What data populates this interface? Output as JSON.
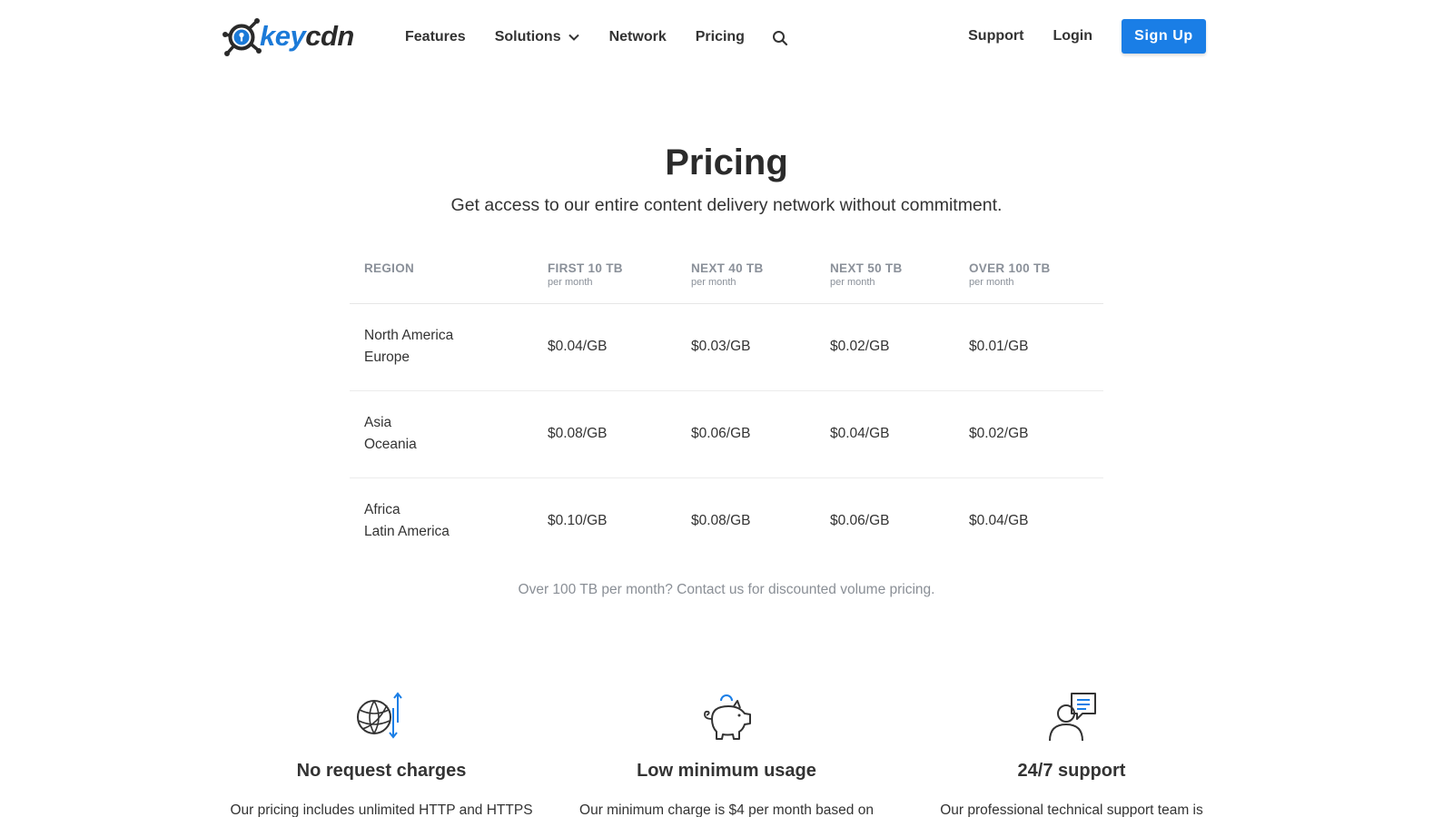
{
  "brand": {
    "key": "key",
    "cdn": "cdn",
    "accent": "#1a7ee6"
  },
  "nav": {
    "items": [
      {
        "label": "Features"
      },
      {
        "label": "Solutions"
      },
      {
        "label": "Network"
      },
      {
        "label": "Pricing"
      }
    ],
    "support": "Support",
    "login": "Login",
    "signup": "Sign Up"
  },
  "hero": {
    "title": "Pricing",
    "subtitle": "Get access to our entire content delivery network without commitment."
  },
  "table": {
    "columns": [
      {
        "label": "REGION",
        "sub": ""
      },
      {
        "label": "FIRST 10 TB",
        "sub": "per month"
      },
      {
        "label": "NEXT 40 TB",
        "sub": "per month"
      },
      {
        "label": "NEXT 50 TB",
        "sub": "per month"
      },
      {
        "label": "OVER 100 TB",
        "sub": "per month"
      }
    ],
    "rows": [
      {
        "region": [
          "North America",
          "Europe"
        ],
        "prices": [
          "$0.04/GB",
          "$0.03/GB",
          "$0.02/GB",
          "$0.01/GB"
        ]
      },
      {
        "region": [
          "Asia",
          "Oceania"
        ],
        "prices": [
          "$0.08/GB",
          "$0.06/GB",
          "$0.04/GB",
          "$0.02/GB"
        ]
      },
      {
        "region": [
          "Africa",
          "Latin America"
        ],
        "prices": [
          "$0.10/GB",
          "$0.08/GB",
          "$0.06/GB",
          "$0.04/GB"
        ]
      }
    ]
  },
  "volume_note": {
    "prefix": "Over 100 TB per month? ",
    "link": "Contact us",
    "suffix": " for discounted volume pricing."
  },
  "features": [
    {
      "icon": "globe-transfer-icon",
      "title": "No request charges",
      "text": "Our pricing includes unlimited HTTP and HTTPS"
    },
    {
      "icon": "piggy-bank-icon",
      "title": "Low minimum usage",
      "text": "Our minimum charge is $4 per month based on"
    },
    {
      "icon": "support-agent-icon",
      "title": "24/7 support",
      "text": "Our professional technical support team is"
    }
  ]
}
